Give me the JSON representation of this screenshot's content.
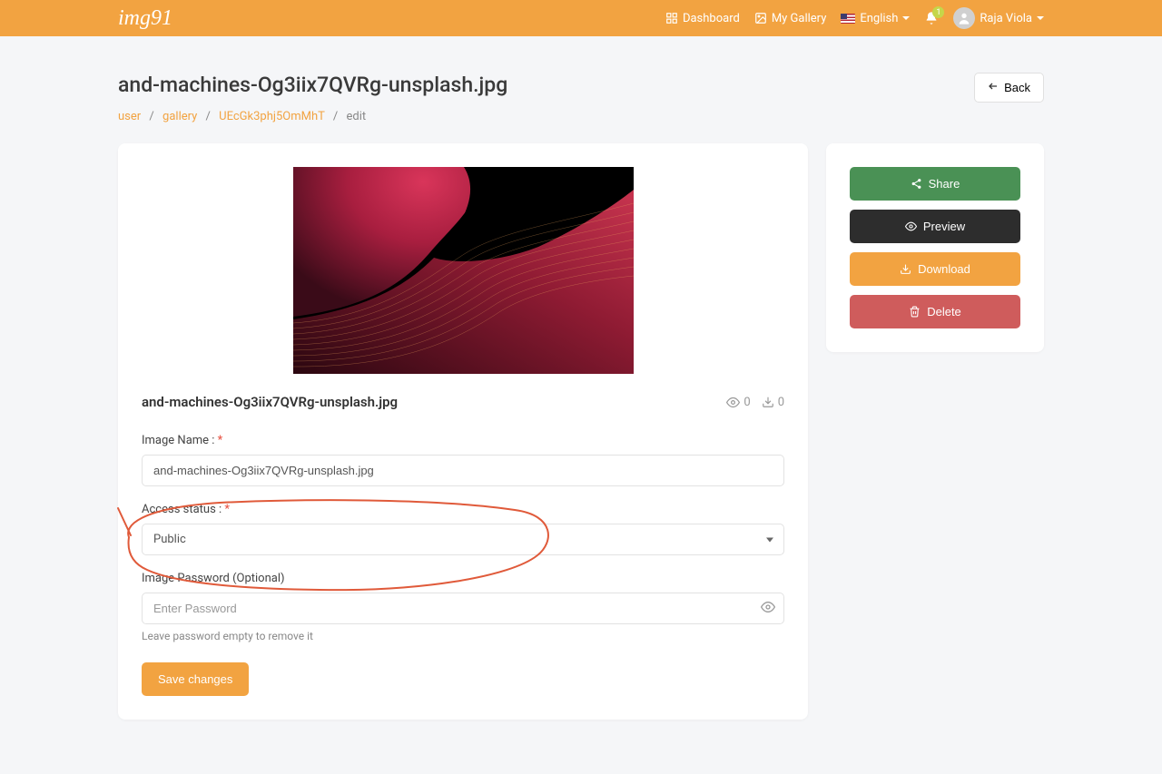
{
  "header": {
    "logo": "img91",
    "nav": {
      "dashboard": "Dashboard",
      "gallery": "My Gallery",
      "language": "English",
      "notifications_count": "1",
      "username": "Raja Viola"
    }
  },
  "page": {
    "title": "and-machines-Og3iix7QVRg-unsplash.jpg",
    "back_label": "Back"
  },
  "breadcrumb": {
    "user": "user",
    "gallery": "gallery",
    "id": "UEcGk3phj5OmMhT",
    "current": "edit"
  },
  "image_card": {
    "title": "and-machines-Og3iix7QVRg-unsplash.jpg",
    "views": "0",
    "downloads": "0"
  },
  "form": {
    "name_label": "Image Name :",
    "name_value": "and-machines-Og3iix7QVRg-unsplash.jpg",
    "access_label": "Access status :",
    "access_value": "Public",
    "password_label": "Image Password (Optional)",
    "password_placeholder": "Enter Password",
    "password_helper": "Leave password empty to remove it",
    "save_label": "Save changes"
  },
  "actions": {
    "share": "Share",
    "preview": "Preview",
    "download": "Download",
    "delete": "Delete"
  }
}
